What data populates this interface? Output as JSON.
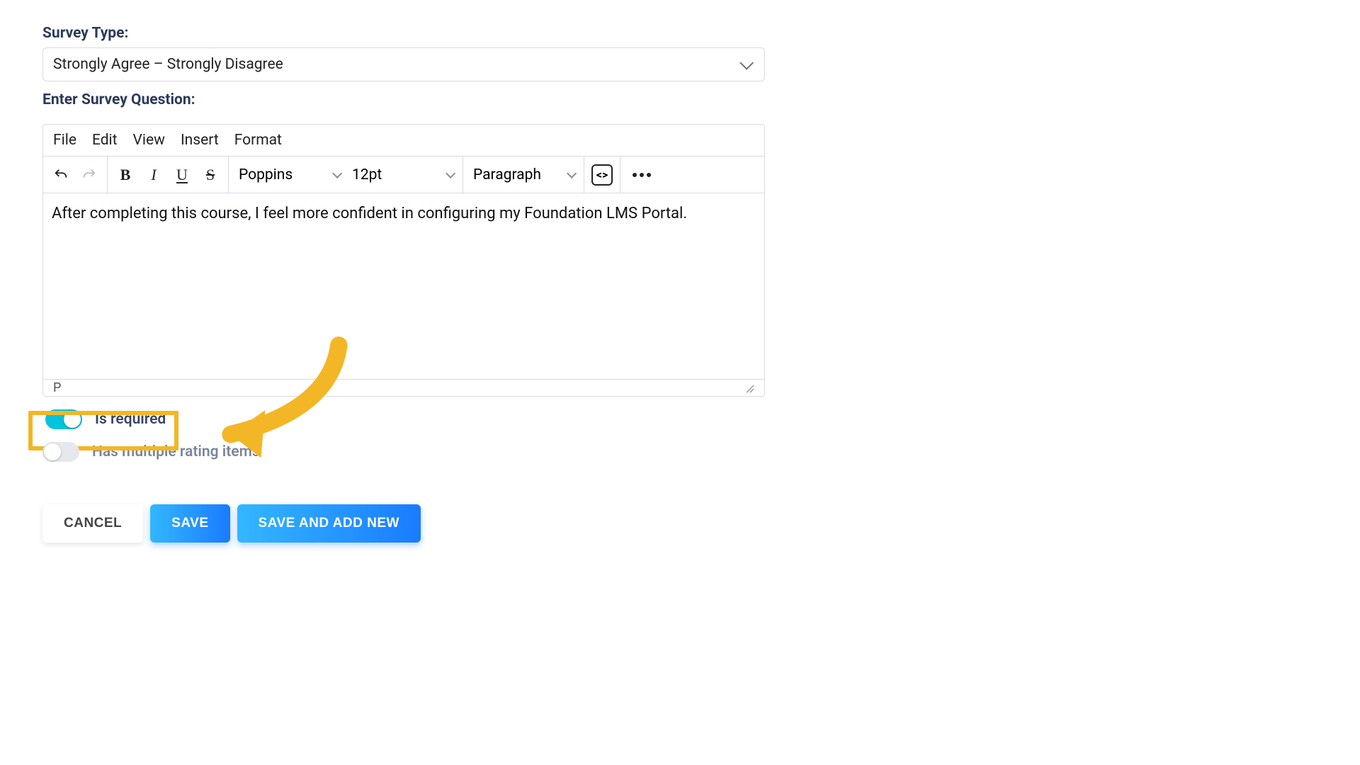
{
  "labels": {
    "survey_type": "Survey Type:",
    "enter_question": "Enter Survey Question:",
    "is_required": "Is required",
    "has_multiple": "Has multiple rating items"
  },
  "survey_type": {
    "selected": "Strongly Agree – Strongly Disagree"
  },
  "editor": {
    "menus": {
      "file": "File",
      "edit": "Edit",
      "view": "View",
      "insert": "Insert",
      "format": "Format"
    },
    "toolbar": {
      "font": "Poppins",
      "size": "12pt",
      "block": "Paragraph"
    },
    "content": "After completing this course, I feel more confident in configuring my Foundation LMS Portal.",
    "status_path": "P"
  },
  "toggles": {
    "is_required": true,
    "has_multiple": false
  },
  "buttons": {
    "cancel": "CANCEL",
    "save": "SAVE",
    "save_add_new": "SAVE AND ADD NEW"
  }
}
